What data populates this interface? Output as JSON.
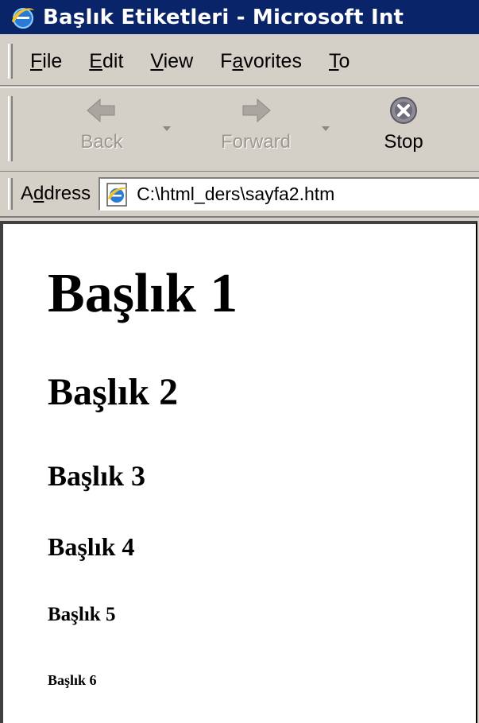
{
  "window": {
    "title": "Başlık Etiketleri - Microsoft Int"
  },
  "menu": {
    "items": [
      {
        "accel": "F",
        "rest": "ile"
      },
      {
        "accel": "E",
        "rest": "dit"
      },
      {
        "accel": "V",
        "rest": "iew"
      },
      {
        "pre": "F",
        "accel": "a",
        "rest": "vorites"
      },
      {
        "accel": "T",
        "rest": "o"
      }
    ]
  },
  "toolbar": {
    "back_label": "Back",
    "forward_label": "Forward",
    "stop_label": "Stop"
  },
  "address": {
    "label_pre": "A",
    "label_accel": "d",
    "label_rest": "dress",
    "value": "C:\\html_ders\\sayfa2.htm"
  },
  "content": {
    "h1": "Başlık 1",
    "h2": "Başlık 2",
    "h3": "Başlık 3",
    "h4": "Başlık 4",
    "h5": "Başlık 5",
    "h6": "Başlık 6"
  },
  "colors": {
    "titlebar": "#0a246a",
    "chrome": "#d4d0c8"
  },
  "icons": {
    "title_icon": "ie-logo-icon",
    "back": "back-arrow-icon",
    "forward": "forward-arrow-icon",
    "stop": "stop-icon",
    "page": "ie-page-icon"
  }
}
